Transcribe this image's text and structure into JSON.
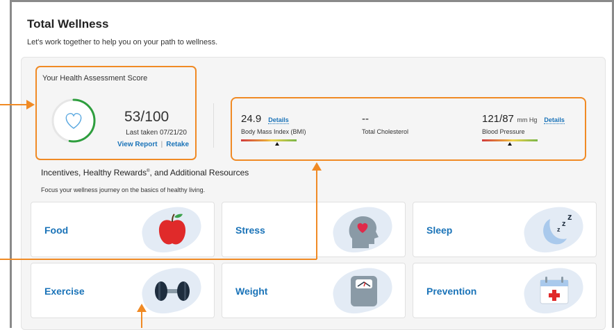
{
  "page": {
    "title": "Total Wellness",
    "subtitle": "Let's work together to help you on your path to wellness."
  },
  "assessment": {
    "title": "Your Health Assessment Score",
    "score": "53/100",
    "score_fraction": 0.53,
    "last_taken": "Last taken 07/21/20",
    "view_report_label": "View Report",
    "retake_label": "Retake",
    "separator": "|"
  },
  "metrics": {
    "bmi": {
      "value": "24.9",
      "details_label": "Details",
      "label": "Body Mass Index (BMI)",
      "gauge_position": 0.65
    },
    "cholesterol": {
      "value": "--",
      "label": "Total Cholesterol"
    },
    "bp": {
      "value": "121/87",
      "unit": "mm Hg",
      "details_label": "Details",
      "label": "Blood Pressure",
      "gauge_position": 0.5
    }
  },
  "incentives": {
    "title": "Incentives, Healthy Rewards",
    "title_mark": "®",
    "title_suffix": ", and Additional Resources",
    "subtitle": "Focus your wellness journey on the basics of healthy living."
  },
  "cards": [
    {
      "label": "Food",
      "icon": "apple-icon"
    },
    {
      "label": "Stress",
      "icon": "head-heart-icon"
    },
    {
      "label": "Sleep",
      "icon": "moon-zzz-icon"
    },
    {
      "label": "Exercise",
      "icon": "dumbbell-icon"
    },
    {
      "label": "Weight",
      "icon": "scale-icon"
    },
    {
      "label": "Prevention",
      "icon": "calendar-medical-icon"
    }
  ],
  "colors": {
    "accent_orange": "#f08a24",
    "link_blue": "#1a73b8",
    "ring_green": "#2e9e3e"
  }
}
